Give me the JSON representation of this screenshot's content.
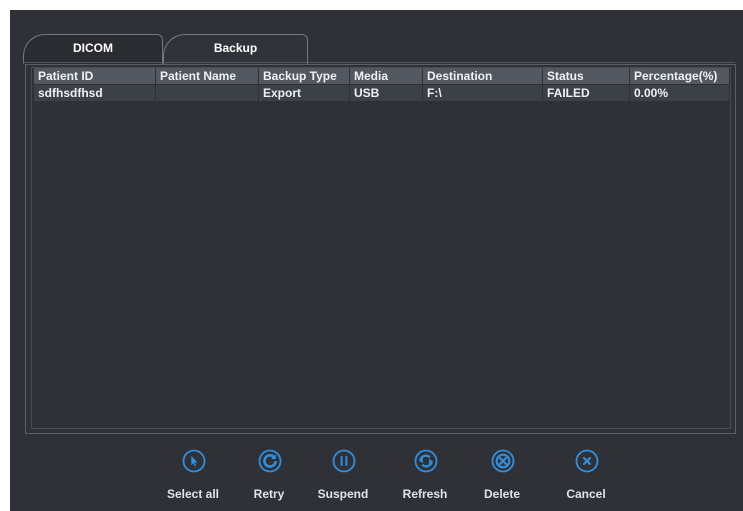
{
  "tabs": {
    "dicom": "DICOM",
    "backup": "Backup"
  },
  "table": {
    "headers": [
      "Patient ID",
      "Patient Name",
      "Backup Type",
      "Media",
      "Destination",
      "Status",
      "Percentage(%)"
    ],
    "rows": [
      [
        "sdfhsdfhsd",
        "",
        "Export",
        "USB",
        "F:\\",
        "FAILED",
        "0.00%"
      ]
    ]
  },
  "toolbar": {
    "select_all": "Select all",
    "retry": "Retry",
    "suspend": "Suspend",
    "refresh": "Refresh",
    "delete": "Delete",
    "cancel": "Cancel"
  },
  "colors": {
    "icon_accent": "#2f8fe0",
    "background": "#2f3136",
    "header_row": "#53575f",
    "selected_row": "#3c4047"
  }
}
